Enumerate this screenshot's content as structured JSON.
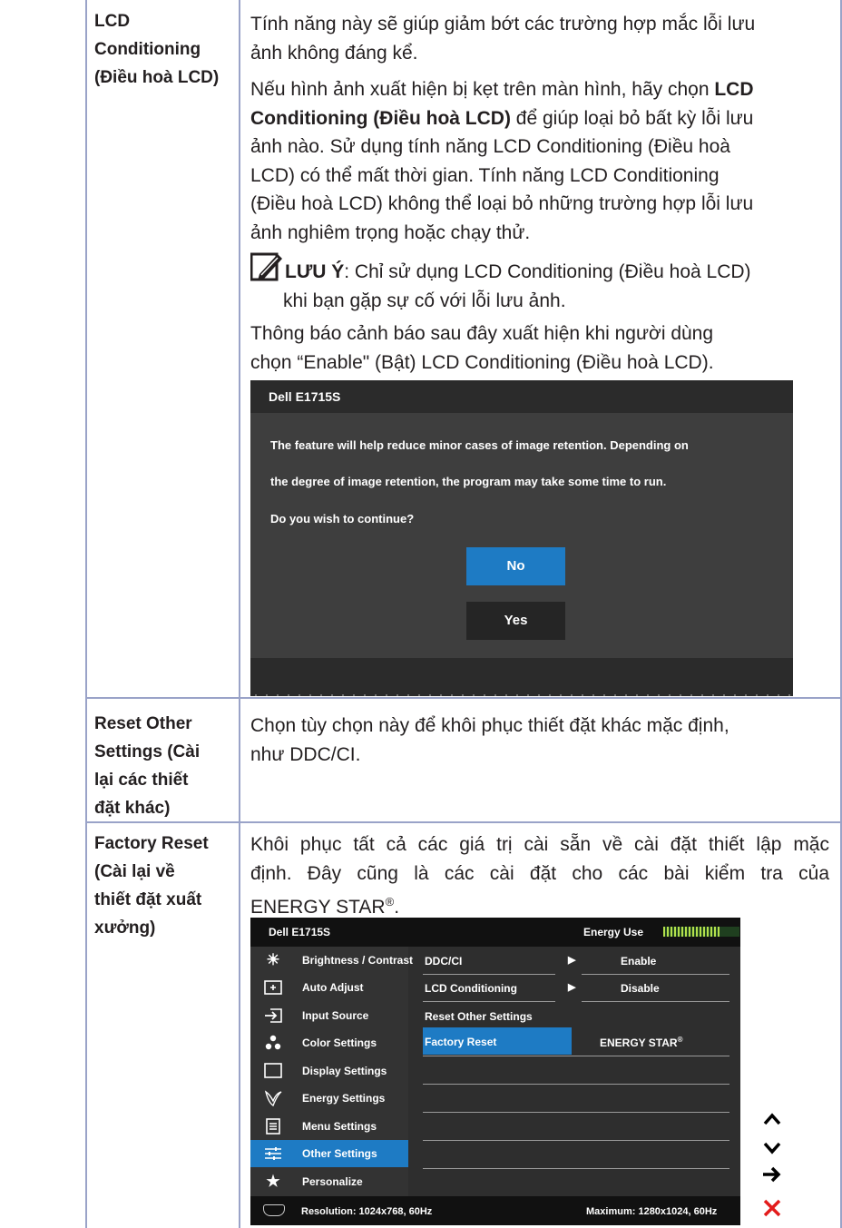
{
  "rows": {
    "lcd": {
      "label_lines": [
        "LCD",
        "Conditioning",
        "(Điều hoà LCD)"
      ],
      "p1_lines": [
        "Tính năng này sẽ giúp giảm bớt các trường hợp mắc lỗi lưu",
        "ảnh không đáng kể."
      ],
      "p2_line1_a": "Nếu hình ảnh xuất hiện bị kẹt trên màn hình, hãy chọn ",
      "p2_line1_b": "LCD",
      "p2_line2_a": "Conditioning (Điều hoà LCD)",
      "p2_line2_b": " để giúp loại bỏ bất kỳ lỗi lưu",
      "p2_rest_lines": [
        "ảnh nào. Sử dụng tính năng LCD Conditioning (Điều hoà",
        "LCD) có thể mất thời gian. Tính năng LCD Conditioning",
        "(Điều hoà LCD) không thể loại bỏ những trường hợp lỗi lưu",
        "ảnh nghiêm trọng hoặc chạy thử."
      ],
      "note_label": "LƯU Ý",
      "note_text": ": Chỉ sử dụng LCD Conditioning (Điều hoà LCD)",
      "note_line2": "khi bạn gặp sự cố với lỗi lưu ảnh.",
      "p3_lines": [
        "Thông báo cảnh báo sau đây xuất hiện khi người dùng",
        "chọn “Enable\" (Bật) LCD Conditioning (Điều hoà LCD)."
      ]
    },
    "reset_other": {
      "label_lines": [
        "Reset Other",
        "Settings (Cài",
        "lại các thiết",
        "đặt khác)"
      ],
      "text_lines": [
        "Chọn tùy chọn này để khôi phục thiết đặt khác mặc định,",
        "như DDC/CI."
      ]
    },
    "factory": {
      "label_lines": [
        "Factory Reset",
        "(Cài lại về",
        "thiết đặt xuất",
        "xưởng)"
      ],
      "text_line1": "Khôi phục tất cả các giá trị cài sẵn về cài đặt thiết lập mặc",
      "text_line2": "định. Đây cũng là các cài đặt cho các bài kiểm tra của",
      "text_line3": "ENERGY STAR",
      "text_line3_sup": "®",
      "text_line3_end": "."
    }
  },
  "dialog": {
    "title": "Dell E1715S",
    "lines": [
      "The feature will help reduce minor cases of image retention. Depending on",
      "the degree of image retention, the program may take some time to run.",
      "Do you wish to continue?"
    ],
    "no_label": "No",
    "yes_label": "Yes",
    "colors": {
      "no": "#1e7bc4",
      "yes": "#252525"
    }
  },
  "osd": {
    "title": "Dell E1715S",
    "energy_label": "Energy Use",
    "energy_level": 0.75,
    "menu": [
      {
        "label": "Brightness / Contrast",
        "icon": "brightness-icon"
      },
      {
        "label": "Auto Adjust",
        "icon": "auto-adjust-icon"
      },
      {
        "label": "Input Source",
        "icon": "input-source-icon"
      },
      {
        "label": "Color Settings",
        "icon": "color-settings-icon"
      },
      {
        "label": "Display Settings",
        "icon": "display-settings-icon"
      },
      {
        "label": "Energy Settings",
        "icon": "energy-settings-icon"
      },
      {
        "label": "Menu Settings",
        "icon": "menu-settings-icon"
      },
      {
        "label": "Other Settings",
        "icon": "other-settings-icon",
        "selected": true
      },
      {
        "label": "Personalize",
        "icon": "personalize-icon"
      }
    ],
    "options": [
      {
        "label": "DDC/CI",
        "value": "Enable"
      },
      {
        "label": "LCD Conditioning",
        "value": "Disable"
      },
      {
        "label": "Reset Other Settings"
      },
      {
        "label": "Factory Reset",
        "value": "ENERGY STAR",
        "value_sup": "®",
        "selected": true
      }
    ],
    "resolution": "Resolution: 1024x768, 60Hz",
    "maximum": "Maximum: 1280x1024, 60Hz",
    "accent": "#1e7bc4",
    "nav": [
      "up-icon",
      "down-icon",
      "enter-icon",
      "exit-icon"
    ]
  }
}
